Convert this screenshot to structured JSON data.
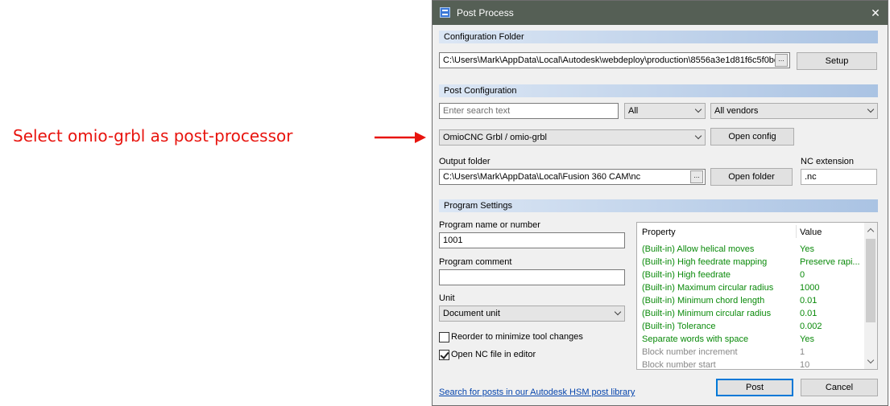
{
  "annotation": {
    "text": "Select omio-grbl as post-processor",
    "color": "#e8140e"
  },
  "window": {
    "title": "Post Process"
  },
  "config_section": {
    "header": "Configuration Folder",
    "path": "C:\\Users\\Mark\\AppData\\Local\\Autodesk\\webdeploy\\production\\8556a3e1d81f6c5f0bc",
    "browse_label": "...",
    "setup_label": "Setup"
  },
  "post_section": {
    "header": "Post Configuration",
    "search_placeholder": "Enter search text",
    "filter_selected": "All",
    "vendor_selected": "All vendors",
    "post_selected": "OmioCNC Grbl / omio-grbl",
    "open_config_label": "Open config",
    "output_folder_label": "Output folder",
    "output_folder_value": "C:\\Users\\Mark\\AppData\\Local\\Fusion 360 CAM\\nc",
    "browse_label": "...",
    "open_folder_label": "Open folder",
    "nc_extension_label": "NC extension",
    "nc_extension_value": ".nc"
  },
  "program_section": {
    "header": "Program Settings",
    "program_name_label": "Program name or number",
    "program_name_value": "1001",
    "program_comment_label": "Program comment",
    "program_comment_value": "",
    "unit_label": "Unit",
    "unit_selected": "Document unit",
    "reorder_label": "Reorder to minimize tool changes",
    "reorder_checked": false,
    "open_nc_label": "Open NC file in editor",
    "open_nc_checked": true
  },
  "properties": {
    "col_property": "Property",
    "col_value": "Value",
    "rows": [
      {
        "property": "(Built-in) Allow helical moves",
        "value": "Yes",
        "style": "builtin"
      },
      {
        "property": "(Built-in) High feedrate mapping",
        "value": "Preserve rapi...",
        "style": "builtin"
      },
      {
        "property": "(Built-in) High feedrate",
        "value": "0",
        "style": "builtin"
      },
      {
        "property": "(Built-in) Maximum circular radius",
        "value": "1000",
        "style": "builtin"
      },
      {
        "property": "(Built-in) Minimum chord length",
        "value": "0.01",
        "style": "builtin"
      },
      {
        "property": "(Built-in) Minimum circular radius",
        "value": "0.01",
        "style": "builtin"
      },
      {
        "property": "(Built-in) Tolerance",
        "value": "0.002",
        "style": "builtin"
      },
      {
        "property": "Separate words with space",
        "value": "Yes",
        "style": "builtin"
      },
      {
        "property": "Block number increment",
        "value": "1",
        "style": "grey"
      },
      {
        "property": "Block number start",
        "value": "10",
        "style": "grey"
      }
    ]
  },
  "footer": {
    "link_text": "Search for posts in our Autodesk HSM post library",
    "post_label": "Post",
    "cancel_label": "Cancel"
  },
  "colors": {
    "builtin_text": "#0a8a0a",
    "disabled_text": "#888888",
    "titlebar": "#555f55",
    "link": "#0645ad"
  },
  "icons": [
    "app-icon",
    "close-icon",
    "chevron-down-icon",
    "checkmark-icon",
    "arrow-right-icon"
  ]
}
